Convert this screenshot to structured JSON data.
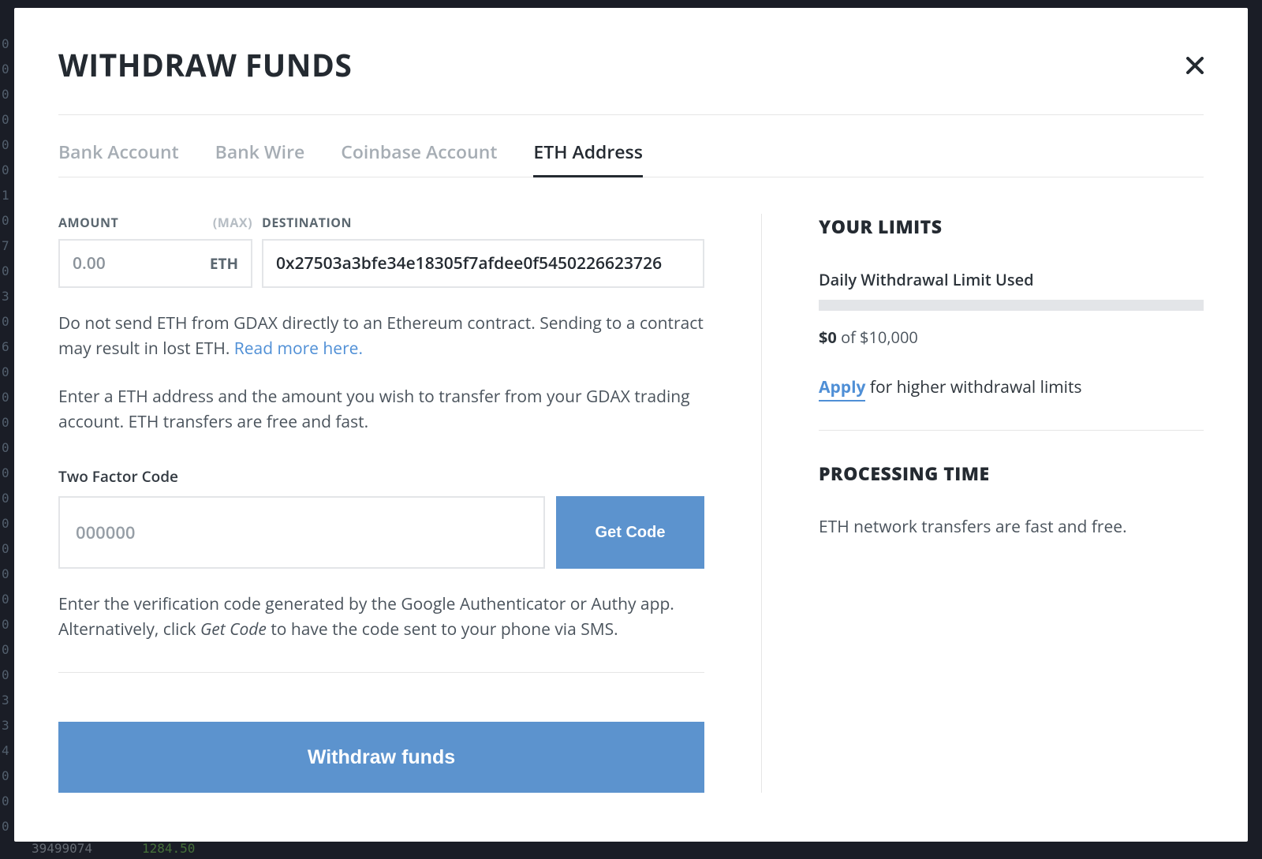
{
  "modal": {
    "title": "WITHDRAW FUNDS"
  },
  "tabs": [
    {
      "label": "Bank Account",
      "active": false
    },
    {
      "label": "Bank Wire",
      "active": false
    },
    {
      "label": "Coinbase Account",
      "active": false
    },
    {
      "label": "ETH Address",
      "active": true
    }
  ],
  "form": {
    "amount_label": "AMOUNT",
    "max_label": "(MAX)",
    "amount_placeholder": "0.00",
    "amount_value": "",
    "amount_suffix": "ETH",
    "destination_label": "DESTINATION",
    "destination_value": "0x27503a3bfe34e18305f7afdee0f5450226623726",
    "warning_prefix": "Do not send ETH from GDAX directly to an Ethereum contract. Sending to a contract may result in lost ETH. ",
    "warning_link": "Read more here.",
    "instructions": "Enter a ETH address and the amount you wish to transfer from your GDAX trading account. ETH transfers are free and fast.",
    "tfa_label": "Two Factor Code",
    "tfa_placeholder": "000000",
    "tfa_value": "",
    "get_code_label": "Get Code",
    "tfa_help_prefix": "Enter the verification code generated by the Google Authenticator or Authy app. Alternatively, click ",
    "tfa_help_italic": "Get Code",
    "tfa_help_suffix": " to have the code sent to your phone via SMS.",
    "submit_label": "Withdraw funds"
  },
  "limits": {
    "title": "YOUR LIMITS",
    "daily_label": "Daily Withdrawal Limit Used",
    "used_amount": "$0",
    "of_text": " of $10,000",
    "apply_link": "Apply",
    "apply_suffix": " for higher withdrawal limits"
  },
  "processing": {
    "title": "PROCESSING TIME",
    "text": "ETH network transfers are fast and free."
  },
  "background": {
    "bottom_left": "39499074",
    "price": "1284.50"
  }
}
